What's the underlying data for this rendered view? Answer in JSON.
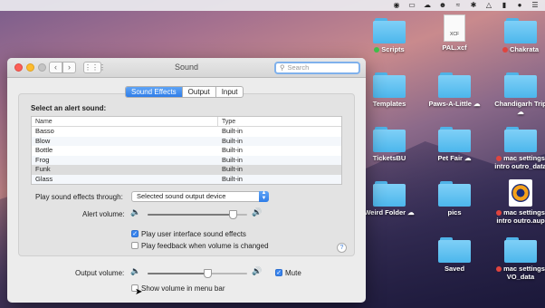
{
  "menubar": {
    "icons": [
      "record-icon",
      "cast-icon",
      "cloud-icon",
      "user-icon",
      "wifi-icon",
      "bluetooth-icon",
      "airplay-icon",
      "battery-icon",
      "spotlight-icon",
      "siri-icon"
    ]
  },
  "desktop": {
    "items": [
      {
        "label": "Scripts",
        "tag": "green"
      },
      {
        "label": "PAL.xcf",
        "kind": "doc",
        "ext": "XCF"
      },
      {
        "label": "Chakrata",
        "tag": "red"
      },
      {
        "label": "Templates"
      },
      {
        "label": "Paws-A-Little ☁"
      },
      {
        "label": "Chandigarh Trip ☁"
      },
      {
        "label": "TicketsBU"
      },
      {
        "label": "Pet Fair ☁"
      },
      {
        "label": "mac settings intro outro_data",
        "tag": "red"
      },
      {
        "label": "Weird Folder ☁"
      },
      {
        "label": "pics"
      },
      {
        "label": "mac settings intro outro.aup",
        "tag": "red",
        "kind": "audio"
      },
      {
        "label": "Saved"
      },
      {
        "label": "mac settings VO_data",
        "tag": "red"
      }
    ]
  },
  "window": {
    "title": "Sound",
    "search_placeholder": "Search",
    "tabs": [
      {
        "label": "Sound Effects",
        "active": true
      },
      {
        "label": "Output",
        "active": false
      },
      {
        "label": "Input",
        "active": false
      }
    ],
    "alert_heading": "Select an alert sound:",
    "table": {
      "columns": [
        "Name",
        "Type"
      ],
      "rows": [
        {
          "name": "Basso",
          "type": "Built-in"
        },
        {
          "name": "Blow",
          "type": "Built-in"
        },
        {
          "name": "Bottle",
          "type": "Built-in"
        },
        {
          "name": "Frog",
          "type": "Built-in"
        },
        {
          "name": "Funk",
          "type": "Built-in",
          "selected": true
        },
        {
          "name": "Glass",
          "type": "Built-in"
        }
      ]
    },
    "play_through_label": "Play sound effects through:",
    "play_through_value": "Selected sound output device",
    "alert_volume_label": "Alert volume:",
    "alert_volume_level": 0.85,
    "ui_sounds_label": "Play user interface sound effects",
    "ui_sounds_checked": true,
    "feedback_label": "Play feedback when volume is changed",
    "feedback_checked": false,
    "help_label": "?",
    "output_volume_label": "Output volume:",
    "output_volume_level": 0.6,
    "mute_label": "Mute",
    "mute_checked": true,
    "show_volume_label": "Show volume in menu bar",
    "show_volume_checked": false
  }
}
